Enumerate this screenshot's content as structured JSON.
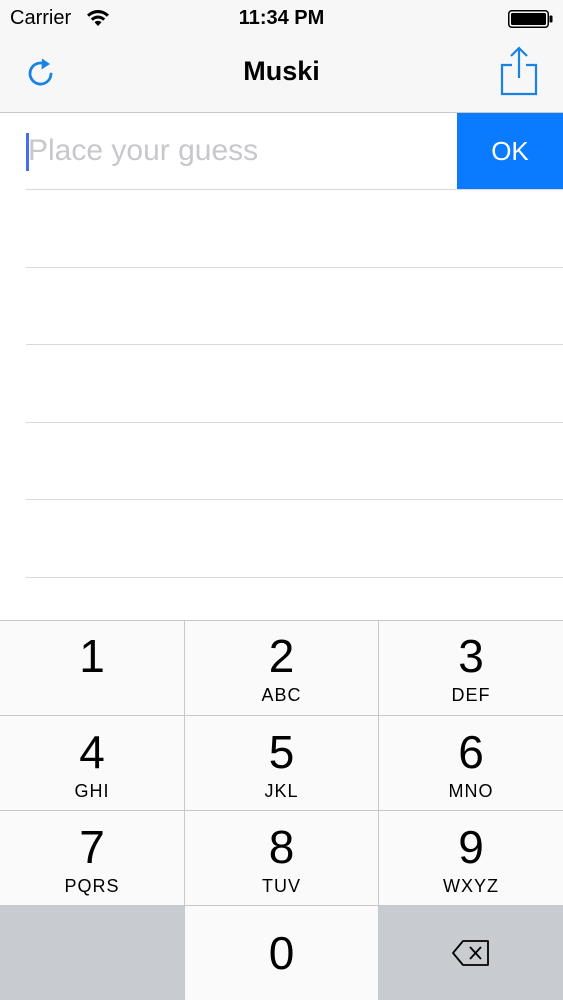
{
  "status_bar": {
    "carrier": "Carrier",
    "time": "11:34 PM",
    "wifi_icon": "wifi-icon",
    "battery_icon": "battery-icon"
  },
  "nav": {
    "title": "Muski",
    "left_icon": "refresh-icon",
    "right_icon": "share-icon",
    "accent_color": "#1a82e2"
  },
  "guess": {
    "placeholder": "Place your guess",
    "value": "",
    "ok_label": "OK",
    "ok_color": "#0a7bff"
  },
  "list": {
    "rows": [
      "",
      "",
      "",
      "",
      ""
    ]
  },
  "keypad": {
    "keys": [
      {
        "digit": "1",
        "letters": ""
      },
      {
        "digit": "2",
        "letters": "ABC"
      },
      {
        "digit": "3",
        "letters": "DEF"
      },
      {
        "digit": "4",
        "letters": "GHI"
      },
      {
        "digit": "5",
        "letters": "JKL"
      },
      {
        "digit": "6",
        "letters": "MNO"
      },
      {
        "digit": "7",
        "letters": "PQRS"
      },
      {
        "digit": "8",
        "letters": "TUV"
      },
      {
        "digit": "9",
        "letters": "WXYZ"
      },
      {
        "digit": "0",
        "letters": ""
      }
    ],
    "delete_icon": "backspace-icon"
  }
}
